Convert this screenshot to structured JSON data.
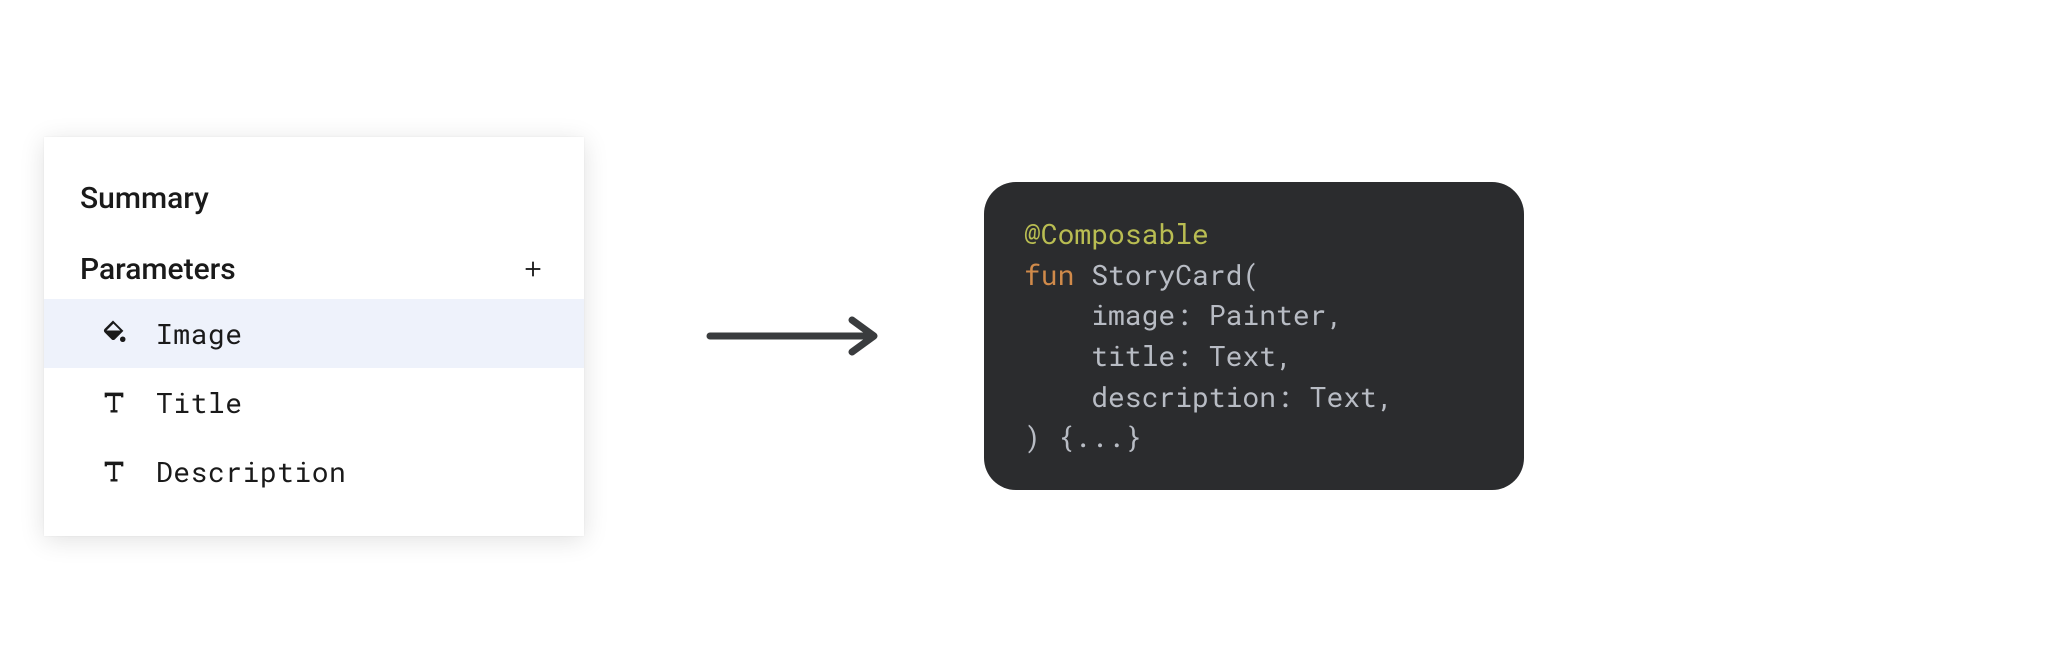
{
  "panel": {
    "title": "Summary",
    "section": "Parameters",
    "items": [
      {
        "label": "Image",
        "iconName": "paint-bucket-icon",
        "selected": true
      },
      {
        "label": "Title",
        "iconName": "text-t-icon",
        "selected": false
      },
      {
        "label": "Description",
        "iconName": "text-t-icon",
        "selected": false
      }
    ]
  },
  "code": {
    "annotation": "@Composable",
    "keyword": "fun",
    "funcName": "StoryCard(",
    "params": [
      "image: Painter,",
      "title: Text,",
      "description: Text,"
    ],
    "closing": ") {...}"
  }
}
